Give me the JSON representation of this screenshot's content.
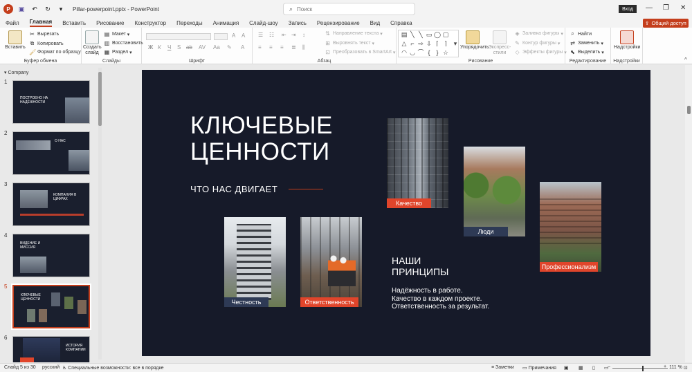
{
  "titlebar": {
    "app_icon": "P",
    "save_icon": "💾",
    "undo_icon": "↶",
    "redo_icon": "↻",
    "more_icon": "▾",
    "title": "Pillar-powerpoint.pptx  -  PowerPoint",
    "search_placeholder": "Поиск",
    "signin_label": "Вход",
    "min_icon": "—",
    "max_icon": "❐",
    "close_icon": "✕"
  },
  "menu": {
    "tabs": [
      "Файл",
      "Главная",
      "Вставить",
      "Рисование",
      "Конструктор",
      "Переходы",
      "Анимация",
      "Слайд-шоу",
      "Запись",
      "Рецензирование",
      "Вид",
      "Справка"
    ],
    "share_label": "Общий доступ"
  },
  "ribbon": {
    "clipboard": {
      "label": "Буфер обмена",
      "paste": "Вставить",
      "cut": "Вырезать",
      "copy": "Копировать",
      "format_painter": "Формат по образцу"
    },
    "slides": {
      "label": "Слайды",
      "new_slide": "Создать слайд",
      "layout": "Макет",
      "reset": "Восстановить",
      "section": "Раздел"
    },
    "font": {
      "label": "Шрифт"
    },
    "paragraph": {
      "label": "Абзац",
      "text_direction": "Направление текста",
      "align_text": "Выровнять текст",
      "smartart": "Преобразовать в SmartArt"
    },
    "drawing": {
      "label": "Рисование",
      "arrange": "Упорядочить",
      "quick_styles": "Экспресс-стили",
      "shape_fill": "Заливка фигуры",
      "shape_outline": "Контур фигуры",
      "shape_effects": "Эффекты фигуры"
    },
    "editing": {
      "label": "Редактирование",
      "find": "Найти",
      "replace": "Заменить",
      "select": "Выделить"
    },
    "addins": {
      "label": "Надстройки",
      "button": "Надстройки"
    }
  },
  "thumbs": {
    "section": "Company",
    "items": [
      {
        "num": "1",
        "title": "ПОСТРОЕНО НА НАДЁЖНОСТИ"
      },
      {
        "num": "2",
        "title": "О НАС"
      },
      {
        "num": "3",
        "title": "КОМПАНИЯ В ЦИФРАХ"
      },
      {
        "num": "4",
        "title": "ВИДЕНИЕ И МИССИЯ"
      },
      {
        "num": "5",
        "title": "КЛЮЧЕВЫЕ ЦЕННОСТИ"
      },
      {
        "num": "6",
        "title": "ИСТОРИЯ КОМПАНИИ"
      }
    ]
  },
  "slide": {
    "title_line1": "КЛЮЧЕВЫЕ",
    "title_line2": "ЦЕННОСТИ",
    "subtitle": "ЧТО НАС ДВИГАЕТ",
    "captions": {
      "quality": "Качество",
      "people": "Люди",
      "professionalism": "Профессионализм",
      "honesty": "Честность",
      "responsibility": "Ответственность"
    },
    "principles_line1": "НАШИ",
    "principles_line2": "ПРИНЦИПЫ",
    "body_line1": "Надёжность в работе.",
    "body_line2": "Качество в каждом проекте.",
    "body_line3": "Ответственность за результат.",
    "accent": "#e0452b"
  },
  "status": {
    "slide_of": "Слайд 5 из 30",
    "language": "русский",
    "accessibility": "Специальные возможности: все в порядке",
    "notes": "Заметки",
    "comments": "Примечания",
    "zoom": "111 %"
  }
}
